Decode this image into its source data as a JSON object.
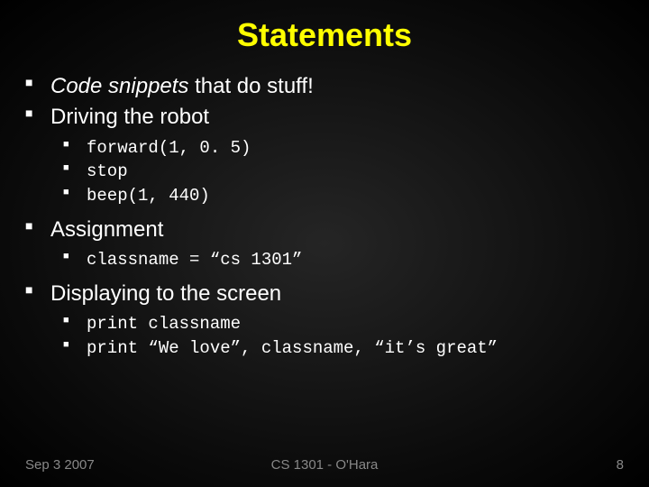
{
  "title": "Statements",
  "bullets": {
    "b0_pre": "Code snippets",
    "b0_post": " that do stuff!",
    "b1": "Driving the robot",
    "b1_sub": [
      "forward(1, 0. 5)",
      "stop",
      "beep(1, 440)"
    ],
    "b2": "Assignment",
    "b2_sub": [
      "classname = “cs 1301”"
    ],
    "b3": "Displaying to the screen",
    "b3_sub": [
      "print classname",
      "print “We love”, classname, “it’s great”"
    ]
  },
  "footer": {
    "left": "Sep 3 2007",
    "center": "CS 1301 - O'Hara",
    "right": "8"
  }
}
